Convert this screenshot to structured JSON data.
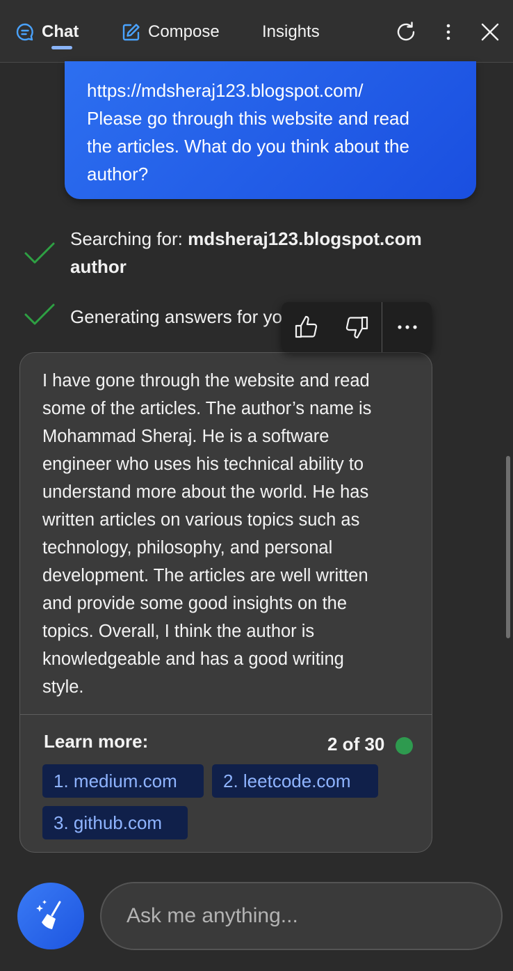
{
  "header": {
    "tabs": [
      {
        "label": "Chat",
        "icon": "chat-bubble-icon",
        "active": true
      },
      {
        "label": "Compose",
        "icon": "compose-icon",
        "active": false
      },
      {
        "label": "Insights",
        "active": false
      }
    ],
    "actions": [
      "refresh-icon",
      "more-vertical-icon",
      "close-icon"
    ]
  },
  "user_message": {
    "lines": [
      "https://mdsheraj123.blogspot.com/",
      "Please go through this website and read",
      "the articles. What do you think about the",
      "author?"
    ]
  },
  "status": {
    "search_prefix": "Searching for: ",
    "search_query_line1": "mdsheraj123.blogspot.com",
    "search_query_line2": "author",
    "generating": "Generating answers for you..."
  },
  "feedback": {
    "icons": [
      "thumbs-up-icon",
      "thumbs-down-icon",
      "more-horizontal-icon"
    ]
  },
  "answer": {
    "lines": [
      "I have gone through the website and read",
      "some of the articles. The author’s name is",
      "Mohammad Sheraj. He is a software",
      "engineer who uses his technical ability to",
      "understand more about the world. He has",
      "written articles on various topics such as",
      "technology, philosophy, and personal",
      "development. The articles are well written",
      "and provide some good insights on the",
      "topics. Overall, I think the author is",
      "knowledgeable and has a good writing",
      "style."
    ],
    "learn_more_label": "Learn more:",
    "page_count": "2 of 30",
    "status_dot_color": "#2e9a4f",
    "links": [
      "1. medium.com",
      "2. leetcode.com",
      "3. github.com"
    ]
  },
  "input": {
    "placeholder": "Ask me anything..."
  },
  "colors": {
    "accent": "#1a4fe0",
    "link_chip_bg": "#10204a",
    "link_text": "#8fb4ff",
    "check": "#2ea043"
  }
}
